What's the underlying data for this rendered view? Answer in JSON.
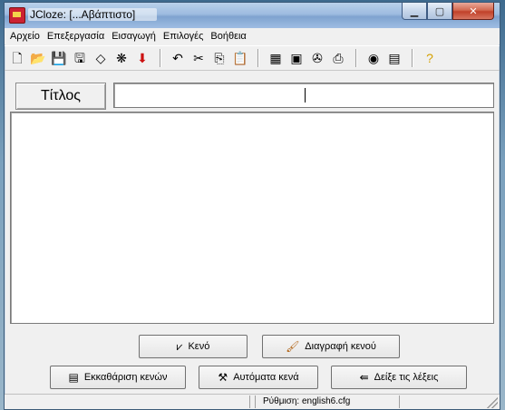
{
  "window": {
    "title": "JCloze: [...Αβάπτιστο]"
  },
  "menu": {
    "items": [
      "Αρχείο",
      "Επεξεργασία",
      "Εισαγωγή",
      "Επιλογές",
      "Βοήθεια"
    ]
  },
  "toolbar": {
    "groups": [
      [
        "new-file-icon",
        "open-folder-icon",
        "save-icon",
        "save-as-icon",
        "eraser-icon",
        "web-icon",
        "exit-arrow-icon"
      ],
      [
        "undo-icon",
        "cut-icon",
        "copy-icon",
        "paste-icon"
      ],
      [
        "create-web-page-icon",
        "create-drag-drop-icon",
        "export-icon",
        "export-print-icon"
      ],
      [
        "config-icon",
        "settings-icon"
      ],
      [
        "help-icon"
      ]
    ],
    "glyphs": {
      "new-file-icon": "🗋",
      "open-folder-icon": "📂",
      "save-icon": "💾",
      "save-as-icon": "🖫",
      "eraser-icon": "◇",
      "web-icon": "❋",
      "exit-arrow-icon": "⬇",
      "undo-icon": "↶",
      "cut-icon": "✂",
      "copy-icon": "⎘",
      "paste-icon": "📋",
      "create-web-page-icon": "▦",
      "create-drag-drop-icon": "▣",
      "export-icon": "✇",
      "export-print-icon": "⎙",
      "config-icon": "◉",
      "settings-icon": "▤",
      "help-icon": "?"
    },
    "colors": {
      "exit-arrow-icon": "#cc1111",
      "help-icon": "#d4a000"
    }
  },
  "form": {
    "title_label": "Τίτλος",
    "title_value": ""
  },
  "buttons": {
    "gap": "Κενό",
    "delete_gap": "Διαγραφή κενού",
    "clear_gaps": "Εκκαθάριση κενών",
    "auto_gaps": "Αυτόματα κενά",
    "show_words": "Δείξε τις λέξεις"
  },
  "status": {
    "config": "Ρύθμιση: english6.cfg"
  }
}
